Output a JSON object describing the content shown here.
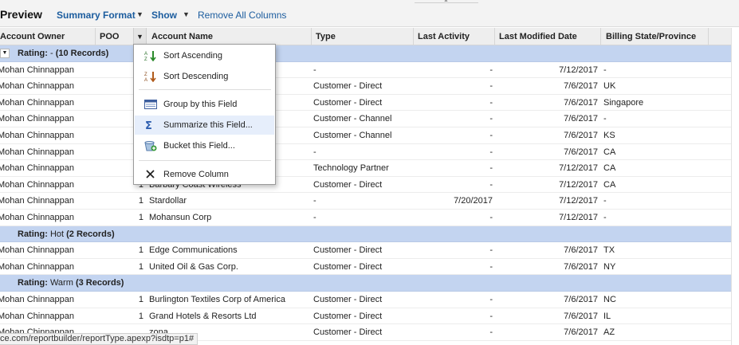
{
  "toolbar": {
    "title": "Preview",
    "summary_format": "Summary Format",
    "show": "Show",
    "remove_all": "Remove All Columns"
  },
  "columns": {
    "owner": "Account Owner",
    "poo": "POO",
    "account": "Account Name",
    "type": "Type",
    "last_activity": "Last Activity",
    "last_modified": "Last Modified Date",
    "billing_state": "Billing State/Province"
  },
  "menu": {
    "sort_asc": "Sort Ascending",
    "sort_desc": "Sort Descending",
    "group_by": "Group by this Field",
    "summarize": "Summarize this Field...",
    "bucket": "Bucket this Field...",
    "remove": "Remove Column"
  },
  "groups": [
    {
      "prefix": "Rating:",
      "value": "- ",
      "count": "(10 Records)",
      "rows": [
        {
          "owner": "Mohan Chinnappan",
          "poo": "",
          "account": "",
          "type": "-",
          "activity": "-",
          "modified": "7/12/2017",
          "state": "-"
        },
        {
          "owner": "Mohan Chinnappan",
          "poo": "",
          "account": "",
          "type": "Customer - Direct",
          "activity": "-",
          "modified": "7/6/2017",
          "state": "UK"
        },
        {
          "owner": "Mohan Chinnappan",
          "poo": "",
          "account": "",
          "type": "Customer - Direct",
          "activity": "-",
          "modified": "7/6/2017",
          "state": "Singapore"
        },
        {
          "owner": "Mohan Chinnappan",
          "poo": "",
          "account": "",
          "type": "Customer - Channel",
          "activity": "-",
          "modified": "7/6/2017",
          "state": "-"
        },
        {
          "owner": "Mohan Chinnappan",
          "poo": "",
          "account": "",
          "type": "Customer - Channel",
          "activity": "-",
          "modified": "7/6/2017",
          "state": "KS"
        },
        {
          "owner": "Mohan Chinnappan",
          "poo": "",
          "account": "",
          "type": "-",
          "activity": "-",
          "modified": "7/6/2017",
          "state": "CA"
        },
        {
          "owner": "Mohan Chinnappan",
          "poo": "",
          "account": "",
          "type": "Technology Partner",
          "activity": "-",
          "modified": "7/12/2017",
          "state": "CA"
        },
        {
          "owner": "Mohan Chinnappan",
          "poo": "1",
          "account": "Barbary Coast Wireless",
          "type": "Customer - Direct",
          "activity": "-",
          "modified": "7/12/2017",
          "state": "CA"
        },
        {
          "owner": "Mohan Chinnappan",
          "poo": "1",
          "account": "Stardollar",
          "type": "-",
          "activity": "7/20/2017",
          "modified": "7/12/2017",
          "state": "-"
        },
        {
          "owner": "Mohan Chinnappan",
          "poo": "1",
          "account": "Mohansun Corp",
          "type": "-",
          "activity": "-",
          "modified": "7/12/2017",
          "state": "-"
        }
      ]
    },
    {
      "prefix": "Rating:",
      "value": "Hot ",
      "count": "(2 Records)",
      "rows": [
        {
          "owner": "Mohan Chinnappan",
          "poo": "1",
          "account": "Edge Communications",
          "type": "Customer - Direct",
          "activity": "-",
          "modified": "7/6/2017",
          "state": "TX"
        },
        {
          "owner": "Mohan Chinnappan",
          "poo": "1",
          "account": "United Oil & Gas Corp.",
          "type": "Customer - Direct",
          "activity": "-",
          "modified": "7/6/2017",
          "state": "NY"
        }
      ]
    },
    {
      "prefix": "Rating:",
      "value": "Warm ",
      "count": "(3 Records)",
      "rows": [
        {
          "owner": "Mohan Chinnappan",
          "poo": "1",
          "account": "Burlington Textiles Corp of America",
          "type": "Customer - Direct",
          "activity": "-",
          "modified": "7/6/2017",
          "state": "NC"
        },
        {
          "owner": "Mohan Chinnappan",
          "poo": "1",
          "account": "Grand Hotels & Resorts Ltd",
          "type": "Customer - Direct",
          "activity": "-",
          "modified": "7/6/2017",
          "state": "IL"
        },
        {
          "owner": "Mohan Chinnappan",
          "poo": "",
          "account": "zona",
          "type": "Customer - Direct",
          "activity": "-",
          "modified": "7/6/2017",
          "state": "AZ"
        }
      ]
    }
  ],
  "status_url": "ce.com/reportbuilder/reportType.apexp?isdtp=p1#",
  "colors": {
    "group_bg": "#c3d4f0",
    "link": "#1b5c9e",
    "menu_hover": "#e6eefb"
  }
}
